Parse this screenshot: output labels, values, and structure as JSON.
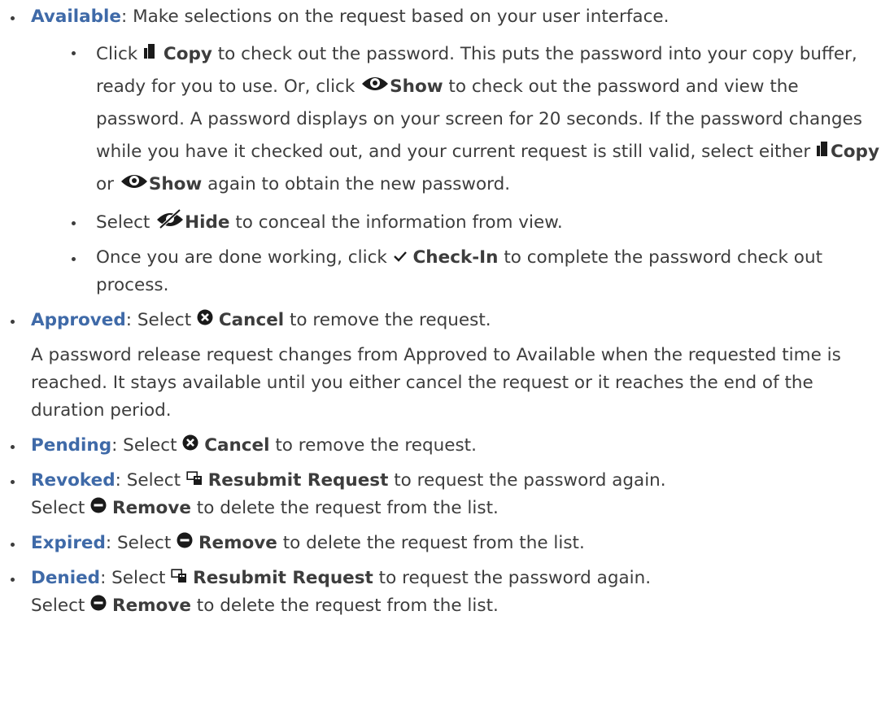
{
  "items": {
    "available": {
      "status": "Available",
      "text": ": Make selections on the request based on your user interface.",
      "sub": {
        "copy": {
          "t1": "Click ",
          "copy_label": "Copy",
          "t2": " to check out the password. This puts the password into your copy buffer, ready for you to use.  Or, click ",
          "show_label": "Show",
          "t3": " to check out the password and view the password. A password displays on your screen for 20 seconds. If the password changes while you have it checked out, and your current request is still valid, select either ",
          "copy_label2": "Copy",
          "t4": " or ",
          "show_label2": "Show",
          "t5": " again to obtain the new password."
        },
        "hide": {
          "t1": "Select ",
          "hide_label": "Hide",
          "t2": " to conceal the information from view."
        },
        "checkin": {
          "t1": "Once you are done working, click ",
          "checkin_label": "Check-In",
          "t2": " to complete the password check out process."
        }
      }
    },
    "approved": {
      "status": "Approved",
      "t1": ": Select ",
      "cancel_label": "Cancel",
      "t2": " to remove the request.",
      "note": "A password release request changes from Approved to Available when the requested time is reached. It stays available until you either cancel the request or it reaches the end of the duration period."
    },
    "pending": {
      "status": "Pending",
      "t1": ": Select ",
      "cancel_label": "Cancel",
      "t2": " to remove the request."
    },
    "revoked": {
      "status": "Revoked",
      "t1": ": Select ",
      "resubmit_label": "Resubmit Request",
      "t2": " to request the password again.",
      "r1": "Select ",
      "remove_label": "Remove",
      "r2": " to delete the request from the list."
    },
    "expired": {
      "status": "Expired",
      "t1": ": Select ",
      "remove_label": "Remove",
      "t2": " to delete the request from the list."
    },
    "denied": {
      "status": "Denied",
      "t1": ": Select ",
      "resubmit_label": "Resubmit Request",
      "t2": " to request the password again.",
      "r1": "Select ",
      "remove_label": "Remove",
      "r2": " to delete the request from the list."
    }
  },
  "icons": {
    "copy": "copy-icon",
    "show": "eye-icon",
    "hide": "eye-slash-icon",
    "checkin": "checkmark-icon",
    "cancel": "x-circle-icon",
    "resubmit": "resubmit-icon",
    "remove": "minus-circle-icon"
  },
  "colors": {
    "status": "#3f6aa8",
    "text": "#3d3d3d"
  }
}
